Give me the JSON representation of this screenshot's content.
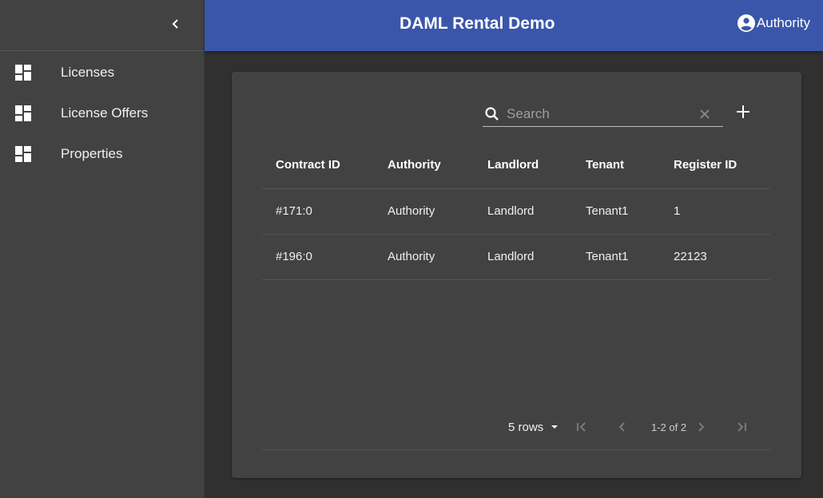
{
  "app": {
    "title": "DAML Rental Demo"
  },
  "user": {
    "name": "Authority"
  },
  "sidebar": {
    "items": [
      {
        "label": "Licenses"
      },
      {
        "label": "License Offers"
      },
      {
        "label": "Properties"
      }
    ]
  },
  "search": {
    "placeholder": "Search",
    "value": ""
  },
  "table": {
    "headers": [
      "Contract ID",
      "Authority",
      "Landlord",
      "Tenant",
      "Register ID"
    ],
    "rows": [
      [
        "#171:0",
        "Authority",
        "Landlord",
        "Tenant1",
        "1"
      ],
      [
        "#196:0",
        "Authority",
        "Landlord",
        "Tenant1",
        "22123"
      ]
    ]
  },
  "pagination": {
    "rows_label": "5 rows",
    "range": "1-2 of 2"
  },
  "colors": {
    "appbar": "#3a56ab",
    "sidebar": "#424242",
    "background": "#303030",
    "card": "#424242"
  },
  "icons": [
    "chevron-left-icon",
    "dashboard-icon",
    "account-circle-icon",
    "search-icon",
    "clear-icon",
    "add-icon",
    "arrow-drop-down-icon",
    "first-page-icon",
    "chevron-left-icon",
    "chevron-right-icon",
    "last-page-icon"
  ]
}
